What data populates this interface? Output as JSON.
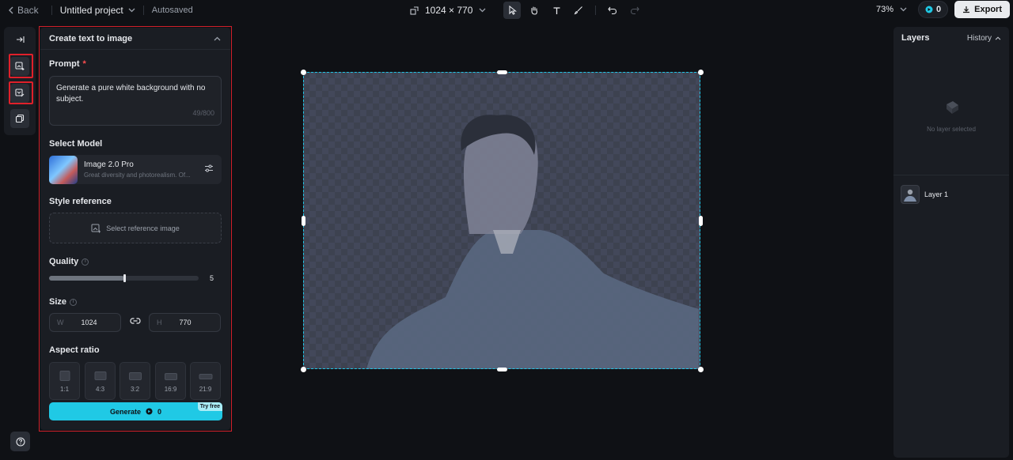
{
  "topbar": {
    "back_label": "Back",
    "project_name": "Untitled project",
    "autosaved": "Autosaved",
    "dimensions": "1024 × 770",
    "zoom": "73%",
    "credits": "0",
    "export_label": "Export"
  },
  "panel": {
    "title": "Create text to image",
    "prompt_label": "Prompt",
    "prompt_required": "*",
    "prompt_text": "Generate a pure white background with no subject.",
    "prompt_count": "49/800",
    "model_label": "Select Model",
    "model_name": "Image 2.0 Pro",
    "model_desc": "Great diversity and photorealism. Of...",
    "style_label": "Style reference",
    "style_button": "Select reference image",
    "quality_label": "Quality",
    "quality_value": "5",
    "quality_fraction": 0.5,
    "size_label": "Size",
    "width_key": "W",
    "width_value": "1024",
    "height_key": "H",
    "height_value": "770",
    "aspect_label": "Aspect ratio",
    "ratios": [
      "1:1",
      "4:3",
      "3:2",
      "16:9",
      "21:9"
    ],
    "generate_label": "Generate",
    "generate_cost": "0",
    "try_free": "Try free"
  },
  "layers": {
    "title": "Layers",
    "history_label": "History",
    "empty_text": "No layer selected",
    "items": [
      {
        "name": "Layer 1"
      }
    ]
  },
  "colors": {
    "accent": "#20c9e5",
    "selection": "#1fc6e6",
    "highlight_outline": "#e0202a"
  }
}
